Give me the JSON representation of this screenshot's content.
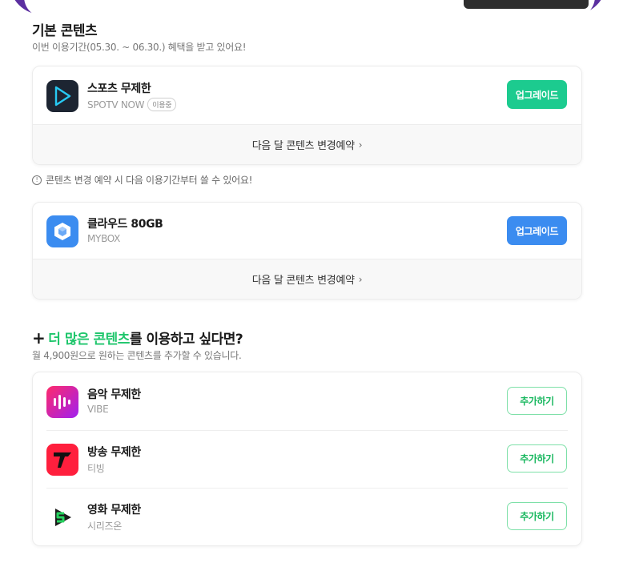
{
  "basic": {
    "title": "기본 콘텐츠",
    "subtitle": "이번 이용기간(05.30. ~ 06.30.) 혜택을 받고 있어요!",
    "items": [
      {
        "name": "스포츠 무제한",
        "provider": "SPOTV NOW",
        "badge": "이용중",
        "upgrade_label": "업그레이드",
        "upgrade_color": "#1ccb8f",
        "footer": "다음 달 콘텐츠 변경예약",
        "icon": "spotv-play-icon"
      },
      {
        "name": "클라우드 80GB",
        "provider": "MYBOX",
        "upgrade_label": "업그레이드",
        "upgrade_color": "#3b8cf0",
        "footer": "다음 달 콘텐츠 변경예약",
        "icon": "mybox-cube-icon"
      }
    ],
    "notice": "콘텐츠 변경 예약 시 다음 이용기간부터 쓸 수 있어요!"
  },
  "more": {
    "title_highlight": "더 많은 콘텐츠",
    "title_rest": "를 이용하고 싶다면?",
    "subtitle": "월 4,900원으로 원하는 콘텐츠를 추가할 수 있습니다.",
    "highlight_color": "#1fc66c",
    "items": [
      {
        "name": "음악 무제한",
        "provider": "VIBE",
        "add_label": "추가하기",
        "icon": "vibe-icon"
      },
      {
        "name": "방송 무제한",
        "provider": "티빙",
        "add_label": "추가하기",
        "icon": "tving-icon"
      },
      {
        "name": "영화 무제한",
        "provider": "시리즈온",
        "add_label": "추가하기",
        "icon": "serieson-icon"
      }
    ]
  }
}
